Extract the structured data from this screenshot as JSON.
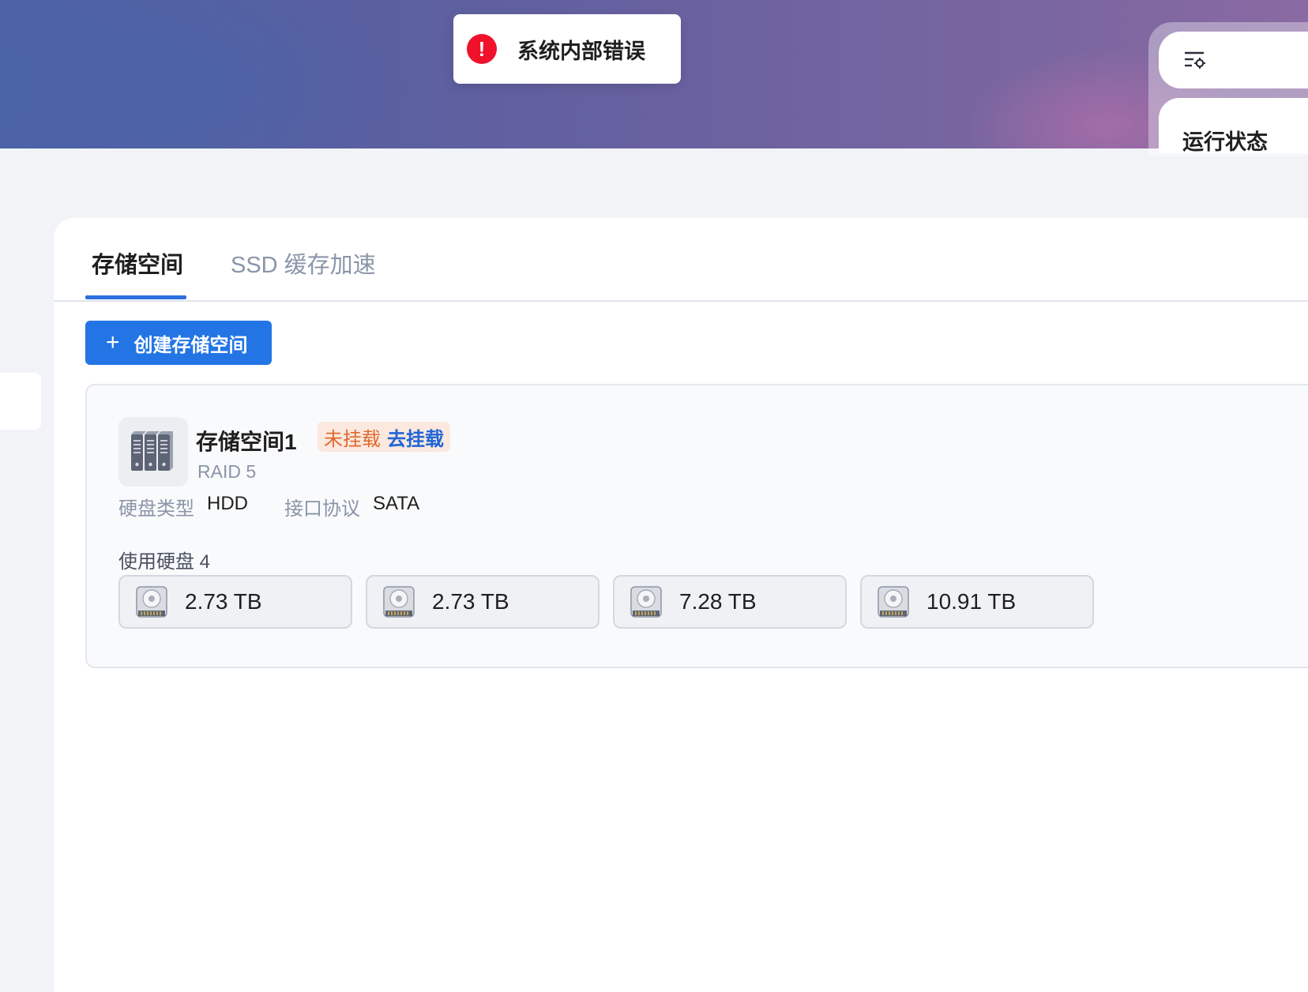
{
  "toast": {
    "icon": "error-icon",
    "message": "系统内部错误"
  },
  "side_panel": {
    "filter_icon": "filter-settings-icon",
    "status_title": "运行状态"
  },
  "tabs": [
    {
      "label": "存储空间",
      "active": true
    },
    {
      "label": "SSD 缓存加速",
      "active": false
    }
  ],
  "create_button": {
    "icon": "plus-icon",
    "label": "创建存储空间"
  },
  "pool": {
    "icon": "server-rack-icon",
    "name": "存储空间1",
    "badge_status": "未挂载",
    "badge_action": "去挂载",
    "raid": "RAID 5",
    "disk_type_label": "硬盘类型",
    "disk_type_value": "HDD",
    "interface_label": "接口协议",
    "interface_value": "SATA",
    "used_disks_label": "使用硬盘 4",
    "disks": [
      {
        "icon": "hard-disk-icon",
        "size": "2.73 TB"
      },
      {
        "icon": "hard-disk-icon",
        "size": "2.73 TB"
      },
      {
        "icon": "hard-disk-icon",
        "size": "7.28 TB"
      },
      {
        "icon": "hard-disk-icon",
        "size": "10.91 TB"
      }
    ]
  },
  "colors": {
    "primary": "#2375e5",
    "error": "#f0112b",
    "warning_text": "#e0692d",
    "link": "#2065d6"
  }
}
